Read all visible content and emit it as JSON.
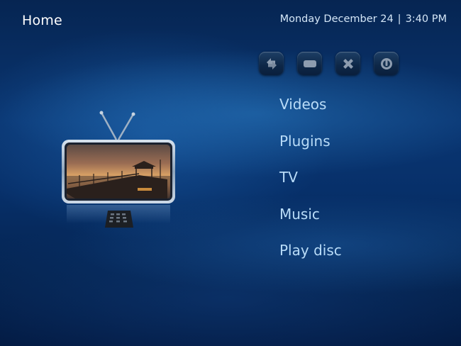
{
  "header": {
    "title": "Home",
    "date": "Monday December 24",
    "separator": "|",
    "time": "3:40 PM"
  },
  "toolbar": {
    "buttons": [
      {
        "icon": "refresh-icon"
      },
      {
        "icon": "minimize-icon"
      },
      {
        "icon": "close-icon"
      },
      {
        "icon": "power-icon"
      }
    ]
  },
  "menu": {
    "items": [
      "Videos",
      "Plugins",
      "TV",
      "Music",
      "Play disc"
    ]
  },
  "colors": {
    "menu_text": "#b9dcf8",
    "title_text": "#ffffff",
    "background": "#0a3672"
  }
}
